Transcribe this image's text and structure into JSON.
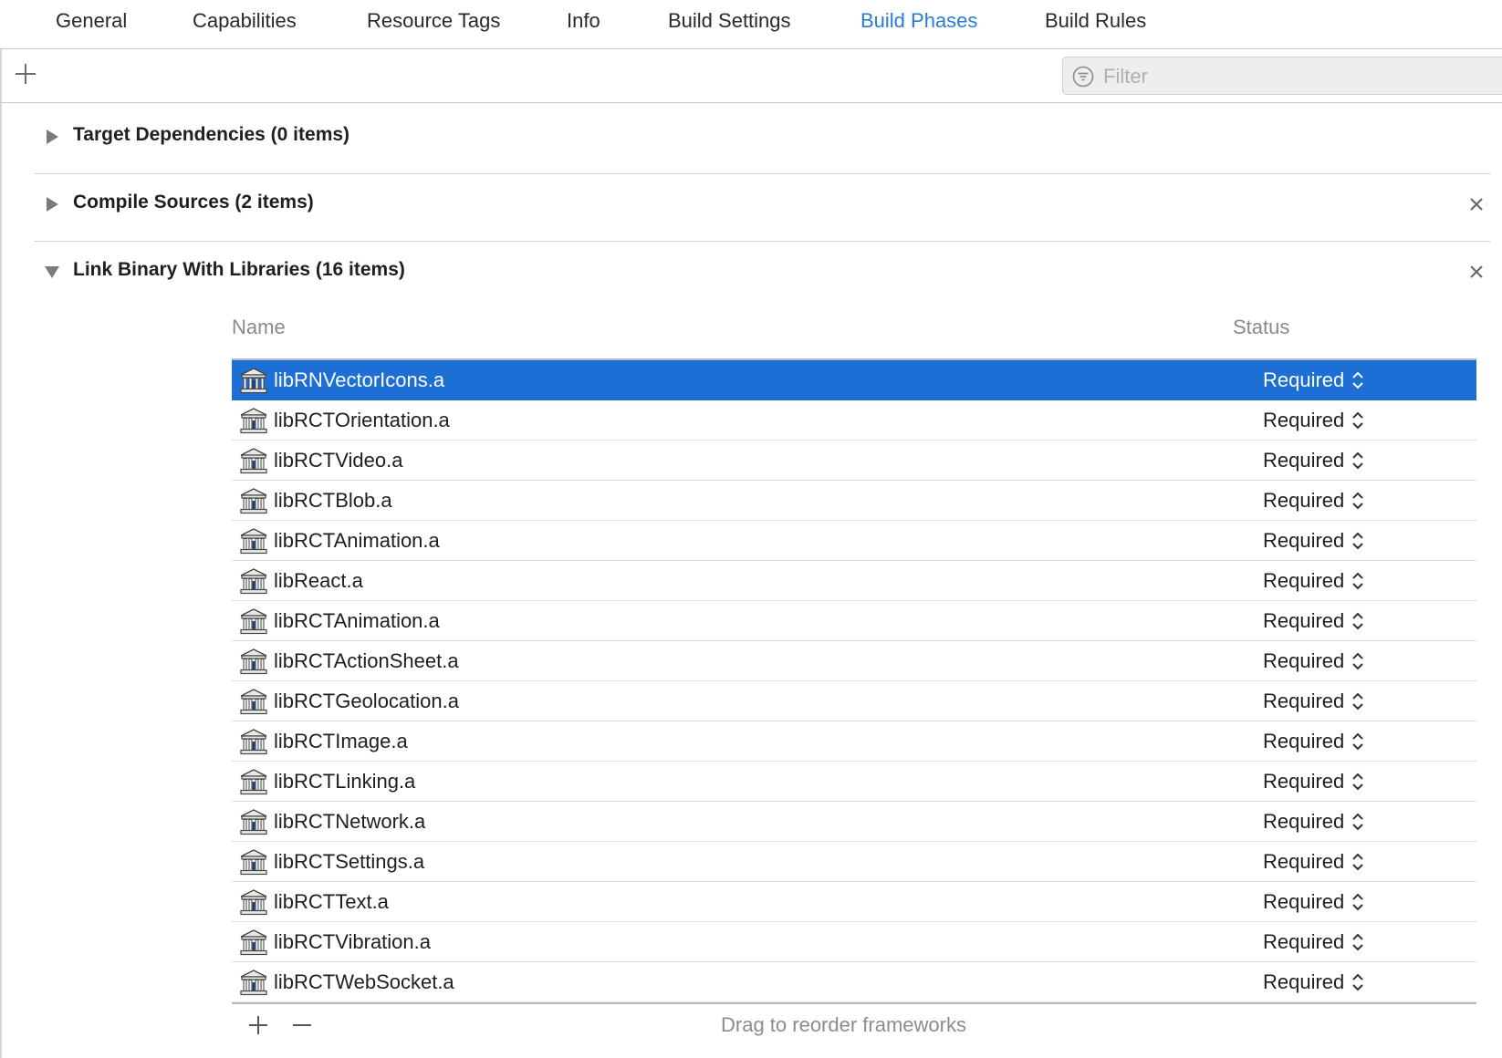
{
  "tabs": [
    {
      "label": "General"
    },
    {
      "label": "Capabilities"
    },
    {
      "label": "Resource Tags"
    },
    {
      "label": "Info"
    },
    {
      "label": "Build Settings"
    },
    {
      "label": "Build Phases",
      "active": true
    },
    {
      "label": "Build Rules"
    }
  ],
  "toolbar": {
    "filter_placeholder": "Filter"
  },
  "phases": [
    {
      "title": "Target Dependencies (0 items)",
      "expanded": false,
      "closable": false
    },
    {
      "title": "Compile Sources (2 items)",
      "expanded": false,
      "closable": true
    },
    {
      "title": "Link Binary With Libraries (16 items)",
      "expanded": true,
      "closable": true
    }
  ],
  "libraries": {
    "col_name": "Name",
    "col_status": "Status",
    "rows": [
      {
        "name": "libRNVectorIcons.a",
        "status": "Required",
        "selected": true
      },
      {
        "name": "libRCTOrientation.a",
        "status": "Required"
      },
      {
        "name": "libRCTVideo.a",
        "status": "Required"
      },
      {
        "name": "libRCTBlob.a",
        "status": "Required"
      },
      {
        "name": "libRCTAnimation.a",
        "status": "Required"
      },
      {
        "name": "libReact.a",
        "status": "Required"
      },
      {
        "name": "libRCTAnimation.a",
        "status": "Required"
      },
      {
        "name": "libRCTActionSheet.a",
        "status": "Required"
      },
      {
        "name": "libRCTGeolocation.a",
        "status": "Required"
      },
      {
        "name": "libRCTImage.a",
        "status": "Required"
      },
      {
        "name": "libRCTLinking.a",
        "status": "Required"
      },
      {
        "name": "libRCTNetwork.a",
        "status": "Required"
      },
      {
        "name": "libRCTSettings.a",
        "status": "Required"
      },
      {
        "name": "libRCTText.a",
        "status": "Required"
      },
      {
        "name": "libRCTVibration.a",
        "status": "Required"
      },
      {
        "name": "libRCTWebSocket.a",
        "status": "Required"
      }
    ],
    "footer_hint": "Drag to reorder frameworks"
  },
  "colors": {
    "accent": "#2b7bd8",
    "selection": "#1d6fd6"
  },
  "icons": {
    "row_icon": "library-icon",
    "add": "plus-icon",
    "remove": "minus-icon",
    "filter": "filter-icon",
    "close": "close-icon",
    "stepper": "up-down-chevron-icon"
  }
}
